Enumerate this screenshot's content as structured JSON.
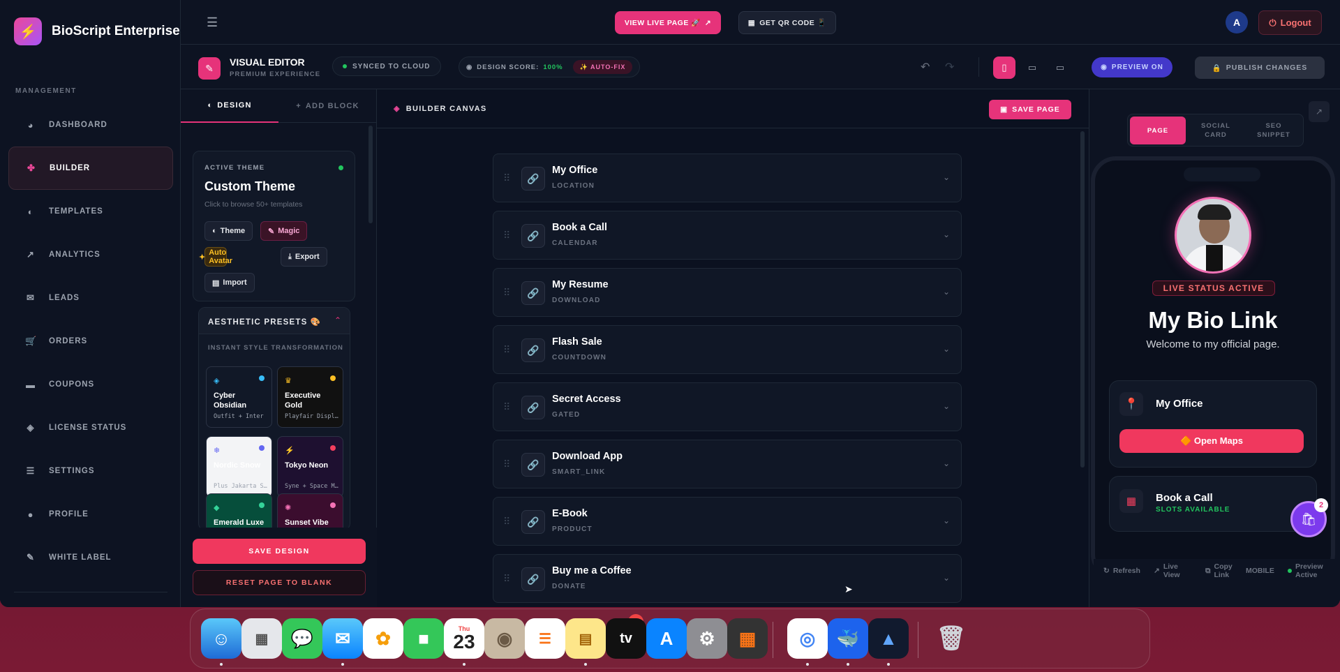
{
  "app": {
    "name": "BioScript Enterprise",
    "logo_icon": "bolt-icon"
  },
  "sidebar": {
    "section_label": "MANAGEMENT",
    "items": [
      {
        "label": "DASHBOARD",
        "icon": "pie-chart-icon"
      },
      {
        "label": "BUILDER",
        "icon": "builder-icon",
        "active": true
      },
      {
        "label": "TEMPLATES",
        "icon": "palette-icon"
      },
      {
        "label": "ANALYTICS",
        "icon": "line-chart-icon"
      },
      {
        "label": "LEADS",
        "icon": "envelope-icon"
      },
      {
        "label": "ORDERS",
        "icon": "cart-icon"
      },
      {
        "label": "COUPONS",
        "icon": "ticket-icon"
      },
      {
        "label": "LICENSE STATUS",
        "icon": "shield-icon"
      },
      {
        "label": "SETTINGS",
        "icon": "sliders-icon"
      },
      {
        "label": "PROFILE",
        "icon": "user-icon"
      },
      {
        "label": "WHITE LABEL",
        "icon": "brush-icon"
      }
    ]
  },
  "topbar": {
    "view_live_label": "VIEW LIVE PAGE 🚀",
    "qr_label": "GET QR CODE 📱",
    "avatar_initial": "A",
    "logout_label": "Logout"
  },
  "editor": {
    "title": "VISUAL EDITOR",
    "subtitle": "PREMIUM EXPERIENCE",
    "sync_label": "SYNCED TO CLOUD",
    "score_label": "DESIGN SCORE:",
    "score_value": "100%",
    "autofix_label": "✨ AUTO-FIX",
    "preview_label": "PREVIEW ON",
    "publish_label": "PUBLISH CHANGES",
    "active_device": "mobile"
  },
  "left_panel": {
    "tabs": [
      {
        "label": "DESIGN",
        "active": true
      },
      {
        "label": "ADD BLOCK"
      }
    ],
    "theme": {
      "label": "ACTIVE THEME",
      "name": "Custom Theme",
      "hint": "Click to browse 50+ templates",
      "buttons": [
        "Theme",
        "Magic",
        "Auto Avatar",
        "Export",
        "Import"
      ]
    },
    "presets": {
      "title": "AESTHETIC PRESETS 🎨",
      "subtitle": "INSTANT STYLE TRANSFORMATION",
      "items": [
        {
          "name": "Cyber Obsidian",
          "fonts": "Outfit + Inter",
          "icon": "shield-icon",
          "dot": "#38bdf8",
          "bg": "#111827",
          "fg": "#ffffff"
        },
        {
          "name": "Executive Gold",
          "fonts": "Playfair Display",
          "icon": "crown-icon",
          "dot": "#fbbf24",
          "bg": "#111111",
          "fg": "#ffffff"
        },
        {
          "name": "Nordic Snow",
          "fonts": "Plus Jakarta Sans",
          "icon": "snowflake-icon",
          "dot": "#6366f1",
          "bg": "#f3f4f6",
          "fg": "#ffffff"
        },
        {
          "name": "Tokyo Neon",
          "fonts": "Syne + Space Mono",
          "icon": "bolt-icon",
          "dot": "#f43f5e",
          "bg": "#1e1030",
          "fg": "#ffffff"
        },
        {
          "name": "Emerald Luxe",
          "fonts": "",
          "icon": "gem-icon",
          "dot": "#34d399",
          "bg": "#064e3b",
          "fg": "#ffffff"
        },
        {
          "name": "Sunset Vibe",
          "fonts": "",
          "icon": "sun-icon",
          "dot": "#f472b6",
          "bg": "#3b0d2e",
          "fg": "#ffffff"
        }
      ]
    },
    "save_design_label": "SAVE DESIGN",
    "reset_label": "RESET PAGE TO BLANK"
  },
  "canvas": {
    "title": "BUILDER CANVAS",
    "save_label": "SAVE PAGE",
    "blocks": [
      {
        "title": "My Office",
        "type": "LOCATION"
      },
      {
        "title": "Book a Call",
        "type": "CALENDAR"
      },
      {
        "title": "My Resume",
        "type": "DOWNLOAD"
      },
      {
        "title": "Flash Sale",
        "type": "COUNTDOWN"
      },
      {
        "title": "Secret Access",
        "type": "GATED"
      },
      {
        "title": "Download App",
        "type": "SMART_LINK"
      },
      {
        "title": "E-Book",
        "type": "PRODUCT"
      },
      {
        "title": "Buy me a Coffee",
        "type": "DONATE"
      }
    ]
  },
  "preview": {
    "tabs": [
      {
        "label": "PAGE",
        "active": true
      },
      {
        "label": "SOCIAL\nCARD"
      },
      {
        "label": "SEO\nSNIPPET"
      }
    ],
    "status_badge": "LIVE STATUS ACTIVE",
    "title": "My Bio Link",
    "subtitle": "Welcome to my official page.",
    "card1": {
      "label": "My Office",
      "button": "🔶 Open Maps"
    },
    "card2": {
      "label": "Book a Call",
      "slots": "SLOTS AVAILABLE"
    },
    "cart_count": "2",
    "bar": {
      "refresh": "Refresh",
      "live_view": "Live\nView",
      "copy_link": "Copy\nLink",
      "mode": "MOBILE",
      "preview_active": "Preview\nActive"
    }
  },
  "dock": {
    "calendar_day": "Thu",
    "calendar_date": "23",
    "reminders_badge": "5",
    "apps": [
      "finder-icon",
      "launchpad-icon",
      "messages-icon",
      "mail-icon",
      "photos-icon",
      "facetime-icon",
      "calendar-icon",
      "contacts-icon",
      "reminders-icon",
      "notes-icon",
      "appletv-icon",
      "appstore-icon",
      "settings-icon",
      "calculator-icon",
      "chrome-icon",
      "docker-icon",
      "affinity-icon",
      "trash-icon"
    ]
  }
}
